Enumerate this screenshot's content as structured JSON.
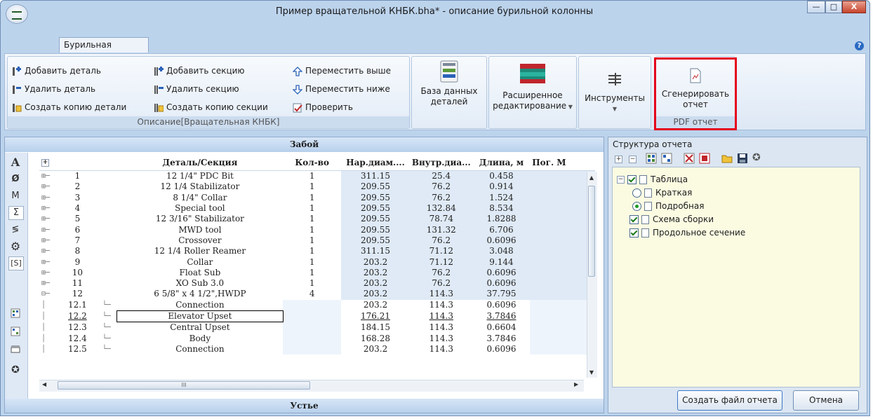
{
  "window": {
    "title": "Пример вращательной КНБК.bha* - описание бурильной колонны",
    "controls": [
      "—",
      "□",
      "X"
    ]
  },
  "ribbon": {
    "tab": "Бурильная колонна",
    "help": "?",
    "group_description": {
      "caption": "Описание[Вращательная КНБК]",
      "add_part": "Добавить деталь",
      "delete_part": "Удалить деталь",
      "copy_part": "Создать копию детали",
      "add_section": "Добавить секцию",
      "delete_section": "Удалить секцию",
      "copy_section": "Создать копию секции",
      "move_up": "Переместить выше",
      "move_down": "Переместить ниже",
      "check": "Проверить"
    },
    "parts_db": {
      "line1": "База данных",
      "line2": "деталей"
    },
    "advanced_edit": {
      "line1": "Расширенное",
      "line2": "редактирование"
    },
    "tools": {
      "label": "Инструменты"
    },
    "pdf_group": {
      "caption": "PDF отчет",
      "line1": "Сгенерировать",
      "line2": "отчет"
    }
  },
  "left_panel": {
    "top_caption": "Забой",
    "bottom_caption": "Устье",
    "side_tools": [
      "A",
      "Ø",
      "M",
      "Σ",
      "≶",
      "⚙",
      "[S]"
    ],
    "columns": [
      "Деталь/Секция",
      "Кол-во",
      "Нар.диам....",
      "Внутр.диа...",
      "Длина, м",
      "Пог. M"
    ],
    "rows": [
      {
        "n": "1",
        "name": "12 1/4\" PDC Bit",
        "qty": "1",
        "od": "311.15",
        "id": "25.4",
        "len": "0.458"
      },
      {
        "n": "2",
        "name": "12 1/4 Stabilizator",
        "qty": "1",
        "od": "209.55",
        "id": "76.2",
        "len": "0.914"
      },
      {
        "n": "3",
        "name": "8 1/4\" Collar",
        "qty": "1",
        "od": "209.55",
        "id": "76.2",
        "len": "1.524"
      },
      {
        "n": "4",
        "name": "Special tool",
        "qty": "1",
        "od": "209.55",
        "id": "132.84",
        "len": "8.534"
      },
      {
        "n": "5",
        "name": "12 3/16\" Stabilizator",
        "qty": "1",
        "od": "209.55",
        "id": "78.74",
        "len": "1.8288"
      },
      {
        "n": "6",
        "name": "MWD tool",
        "qty": "1",
        "od": "209.55",
        "id": "131.32",
        "len": "6.706"
      },
      {
        "n": "7",
        "name": "Crossover",
        "qty": "1",
        "od": "209.55",
        "id": "76.2",
        "len": "0.6096"
      },
      {
        "n": "8",
        "name": "12 1/4 Roller Reamer",
        "qty": "1",
        "od": "311.15",
        "id": "71.12",
        "len": "3.048"
      },
      {
        "n": "9",
        "name": "Collar",
        "qty": "1",
        "od": "203.2",
        "id": "71.12",
        "len": "9.144"
      },
      {
        "n": "10",
        "name": "Float Sub",
        "qty": "1",
        "od": "203.2",
        "id": "76.2",
        "len": "0.6096"
      },
      {
        "n": "11",
        "name": "XO Sub 3.0",
        "qty": "1",
        "od": "203.2",
        "id": "76.2",
        "len": "0.6096"
      },
      {
        "n": "12",
        "name": "6 5/8\" x 4 1/2\",HWDP",
        "qty": "4",
        "od": "203.2",
        "id": "114.3",
        "len": "37.795"
      }
    ],
    "subrows": [
      {
        "n": "12.1",
        "name": "Connection",
        "od": "203.2",
        "id": "114.3",
        "len": "0.6096"
      },
      {
        "n": "12.2",
        "name": "Elevator Upset",
        "od": "176.21",
        "id": "114.3",
        "len": "3.7846"
      },
      {
        "n": "12.3",
        "name": "Central Upset",
        "od": "184.15",
        "id": "114.3",
        "len": "0.6604"
      },
      {
        "n": "12.4",
        "name": "Body",
        "od": "168.28",
        "id": "114.3",
        "len": "3.7846"
      },
      {
        "n": "12.5",
        "name": "Connection",
        "od": "203.2",
        "id": "114.3",
        "len": "0.6096"
      }
    ],
    "hscroll_grip": "III"
  },
  "right_panel": {
    "title": "Структура отчета",
    "tree": {
      "table": "Таблица",
      "brief": "Краткая",
      "detailed": "Подробная",
      "assembly": "Схема сборки",
      "section": "Продольное сечение"
    },
    "create_button": "Создать файл отчета",
    "cancel_button": "Отмена"
  },
  "colors": {
    "highlight": "#e4001b",
    "grid_blue": "#dfeaf6"
  }
}
